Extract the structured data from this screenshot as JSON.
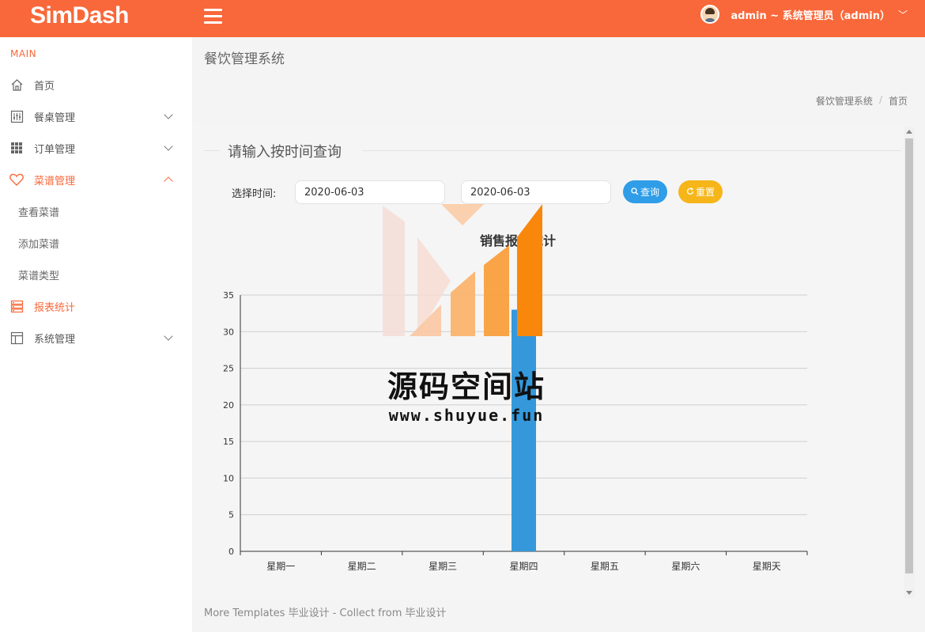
{
  "header": {
    "logo": "SimDash",
    "user_label": "admin ~ 系统管理员（admin）"
  },
  "sidebar": {
    "section": "MAIN",
    "items": [
      {
        "label": "首页",
        "icon": "home-icon"
      },
      {
        "label": "餐桌管理",
        "icon": "sliders-icon"
      },
      {
        "label": "订单管理",
        "icon": "grid-icon"
      },
      {
        "label": "菜谱管理",
        "icon": "heart-icon",
        "expanded": true
      },
      {
        "label": "报表统计",
        "icon": "list-icon",
        "active": true
      },
      {
        "label": "系统管理",
        "icon": "layout-icon"
      }
    ],
    "sub_items": [
      "查看菜谱",
      "添加菜谱",
      "菜谱类型"
    ]
  },
  "page": {
    "title": "餐饮管理系统",
    "breadcrumb": [
      "餐饮管理系统",
      "首页"
    ]
  },
  "query": {
    "legend": "请输入按时间查询",
    "label": "选择时间:",
    "start_date": "2020-06-03",
    "end_date": "2020-06-03",
    "query_btn": "查询",
    "reset_btn": "重置"
  },
  "colors": {
    "brand": "#f9683a",
    "bar": "#3498db",
    "query": "#2f9de8",
    "reset": "#f6b619"
  },
  "chart_data": {
    "type": "bar",
    "title": "销售报表统计",
    "categories": [
      "星期一",
      "星期二",
      "星期三",
      "星期四",
      "星期五",
      "星期六",
      "星期天"
    ],
    "values": [
      0,
      0,
      0,
      33,
      0,
      0,
      0
    ],
    "ylim": [
      0,
      35
    ],
    "yticks": [
      0,
      5,
      10,
      15,
      20,
      25,
      30,
      35
    ],
    "grid": true
  },
  "watermark": {
    "text": "源码空间站",
    "url": "www.shuyue.fun"
  },
  "footer": "More Templates 毕业设计 - Collect from 毕业设计"
}
